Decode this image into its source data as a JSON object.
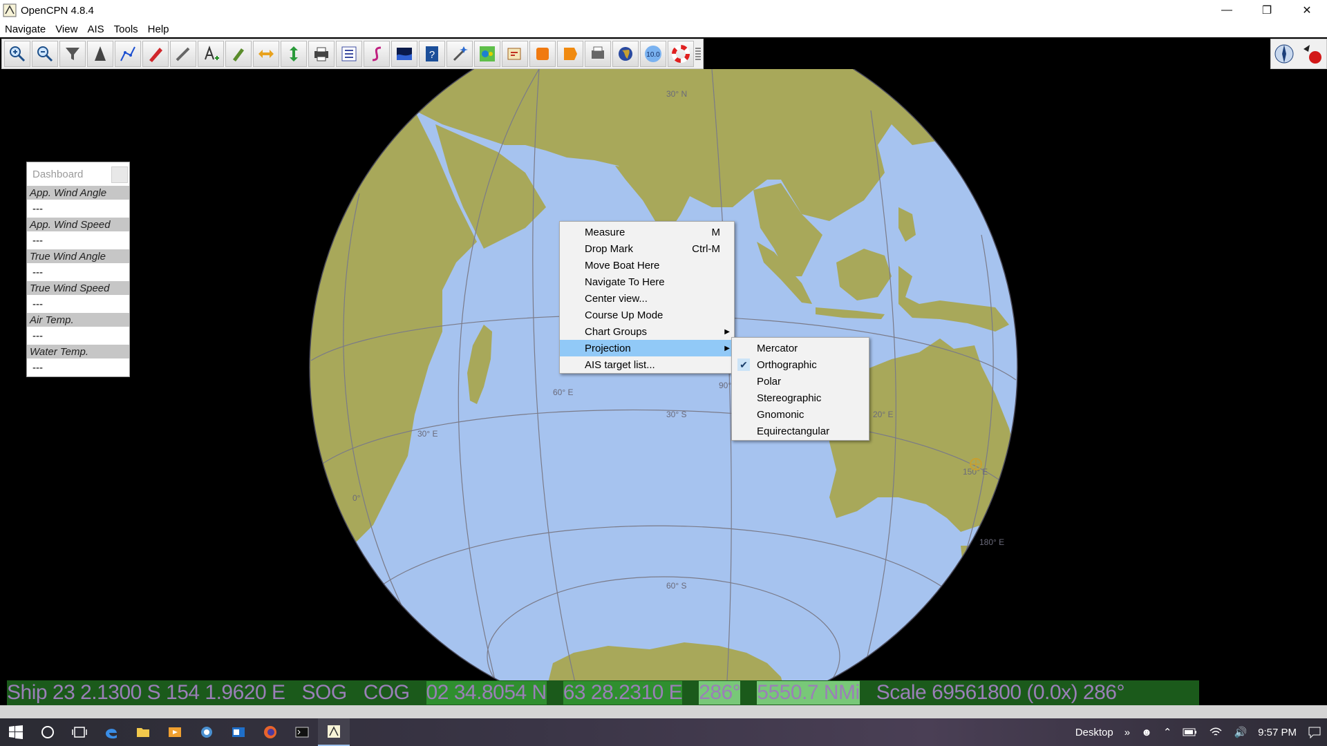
{
  "window": {
    "title": "OpenCPN 4.8.4",
    "minimize": "—",
    "maximize": "❐",
    "close": "✕"
  },
  "menubar": [
    "Navigate",
    "View",
    "AIS",
    "Tools",
    "Help"
  ],
  "toolbar": {
    "buttons": [
      "zoom-in-icon",
      "zoom-out-icon",
      "funnel-icon",
      "ship-icon",
      "route-icon",
      "red-pencil-icon",
      "measure-icon",
      "text-icon",
      "pencil-edit-icon",
      "arrows-horizontal-icon",
      "arrows-vertical-icon",
      "print-icon",
      "list-icon",
      "s-curve-icon",
      "waves-icon",
      "help-icon",
      "wand-icon",
      "layers-icon",
      "paper-icon",
      "orange-square-icon",
      "orange-flag-icon",
      "printer2-icon",
      "globe-icon",
      "value-icon",
      "lifebuoy-icon"
    ],
    "value_badge": "10.0"
  },
  "dashboard": {
    "title": "Dashboard",
    "items": [
      {
        "label": "App. Wind Angle",
        "value": "---"
      },
      {
        "label": "App. Wind Speed",
        "value": "---"
      },
      {
        "label": "True Wind Angle",
        "value": "---"
      },
      {
        "label": "True Wind Speed",
        "value": "---"
      },
      {
        "label": "Air Temp.",
        "value": "---"
      },
      {
        "label": "Water Temp.",
        "value": "---"
      }
    ]
  },
  "grid_labels": {
    "lat30n": "30° N",
    "lat30s": "30° S",
    "lat60s": "60° S",
    "lon0": "0°",
    "lon30e": "30° E",
    "lon60e": "60° E",
    "lon90e": "90°",
    "lon120e": "20° E",
    "lon150e": "150° E",
    "lon180e": "180° E"
  },
  "context_menu": {
    "items": [
      {
        "label": "Measure",
        "accel": "M"
      },
      {
        "label": "Drop Mark",
        "accel": "Ctrl-M"
      },
      {
        "label": "Move Boat Here",
        "accel": ""
      },
      {
        "label": "Navigate To Here",
        "accel": ""
      },
      {
        "label": "Center view...",
        "accel": ""
      },
      {
        "label": "Course Up Mode",
        "accel": ""
      },
      {
        "label": "Chart Groups",
        "accel": ""
      },
      {
        "label": "Projection",
        "accel": ""
      },
      {
        "label": "AIS target list...",
        "accel": ""
      }
    ]
  },
  "projection_submenu": {
    "items": [
      "Mercator",
      "Orthographic",
      "Polar",
      "Stereographic",
      "Gnomonic",
      "Equirectangular"
    ],
    "checked": "Orthographic"
  },
  "statusbar": {
    "ship": "Ship 23 2.1300 S  154 1.9620 E",
    "sog": "SOG",
    "cog": "COG",
    "cursor_lat": "02 34.8054 N",
    "cursor_lon": "63 28.2310 E",
    "bearing": "286°",
    "distance": "5550.7 NMi",
    "scale": "Scale  69561800 (0.0x)  286°"
  },
  "taskbar": {
    "desktop_label": "Desktop",
    "chevron": "»",
    "time": "9:57 PM"
  },
  "colors": {
    "ocean": "#a6c3ef",
    "land": "#a8a85a",
    "grid": "#7a7a88"
  }
}
